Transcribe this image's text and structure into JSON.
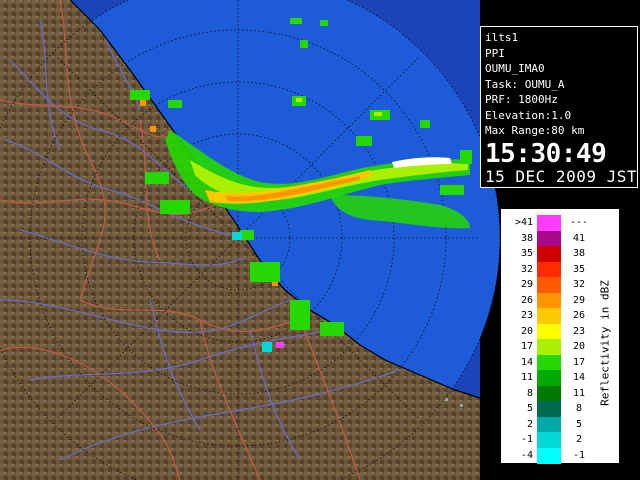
{
  "header": {
    "station": "ilts1",
    "product": "PPI",
    "site": "OUMU_IMA0",
    "task": "Task: OUMU_A",
    "prf": "PRF: 1800Hz",
    "elevation": "Elevation:1.0",
    "max_range": "Max Range:80 km",
    "time": "15:30:49",
    "date": "15 DEC 2009 JST"
  },
  "colors": {
    "ocean": "#1e5bd8",
    "coverage_outer": "#1a44b8",
    "land": "#7a6646",
    "land_dark": "#4a3b25",
    "rivers": "#6a6ad0",
    "boundaries": "#c85a4a"
  },
  "legend": {
    "unit_label": "Reflectivity in dBZ",
    "rows": [
      {
        "low": ">41",
        "high": "---",
        "color": "#ff3cff"
      },
      {
        "low": "38",
        "high": "41",
        "color": "#aa0a8a"
      },
      {
        "low": "35",
        "high": "38",
        "color": "#d00000"
      },
      {
        "low": "32",
        "high": "35",
        "color": "#ff2a00"
      },
      {
        "low": "29",
        "high": "32",
        "color": "#ff5a00"
      },
      {
        "low": "26",
        "high": "29",
        "color": "#ff9600"
      },
      {
        "low": "23",
        "high": "26",
        "color": "#ffc800"
      },
      {
        "low": "20",
        "high": "23",
        "color": "#ffff00"
      },
      {
        "low": "17",
        "high": "20",
        "color": "#a8f000"
      },
      {
        "low": "14",
        "high": "17",
        "color": "#24d800"
      },
      {
        "low": "11",
        "high": "14",
        "color": "#00aa00"
      },
      {
        "low": "8",
        "high": "11",
        "color": "#007a00"
      },
      {
        "low": "5",
        "high": "8",
        "color": "#006a50"
      },
      {
        "low": "2",
        "high": "5",
        "color": "#00a8a8"
      },
      {
        "low": "-1",
        "high": "2",
        "color": "#00d8d8"
      },
      {
        "low": "-4",
        "high": "-1",
        "color": "#00ffff"
      }
    ]
  }
}
